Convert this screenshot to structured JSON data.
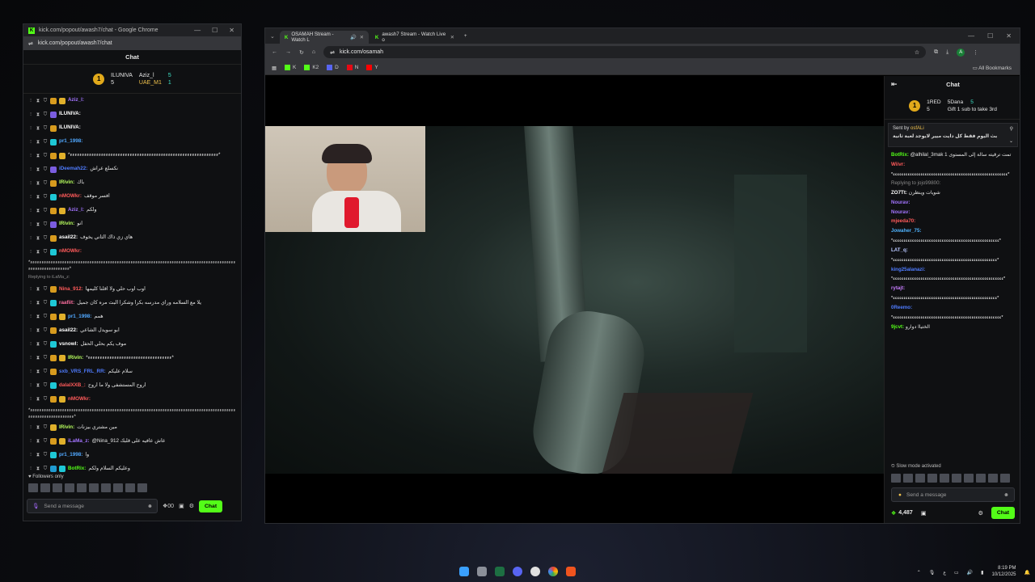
{
  "popout": {
    "window_title": "kick.com/popout/awash7/chat - Google Chrome",
    "url": "kick.com/popout/awash7/chat",
    "chat_title": "Chat",
    "pinned": {
      "rank": "1",
      "user1": "ILUNIVA",
      "user1_count": "5",
      "user2": "Aziz_l",
      "user2_count": "5",
      "user3": "UAE_M1",
      "user3_count": "1"
    },
    "messages": [
      {
        "user": "Aziz_l:",
        "text": "",
        "color": "#a374ff"
      },
      {
        "user": "ILUNIVA:",
        "text": "",
        "color": "#ffffff"
      },
      {
        "user": "ILUNIVA:",
        "text": "",
        "color": "#ffffff"
      },
      {
        "user": "pr1_1998:",
        "text": "",
        "color": "#50a8ff"
      },
      {
        "user": "",
        "text": "*ءءءءءءءءءءءءءءءءءءءءءءءءءءءءءءءءءءءءءءءءءءءءءءءءءءءءءءءءءءءءءء*",
        "color": "#ffffff"
      },
      {
        "user": "iDeemah22:",
        "text": "نكسلع عراش",
        "color": "#4f7cff"
      },
      {
        "user": "IRivin:",
        "text": "باك",
        "color": "#b8ff5e"
      },
      {
        "user": "nMOWkr:",
        "text": "افسر موقف",
        "color": "#ff5a5a"
      },
      {
        "user": "Aziz_l:",
        "text": "ولكم",
        "color": "#a374ff"
      },
      {
        "user": "IRivin:",
        "text": "انو",
        "color": "#b8ff5e"
      },
      {
        "user": "asail22:",
        "text": "هاي زي ذاك الثاني يخوف",
        "color": "#ffffff"
      },
      {
        "user": "nMOWkr:",
        "text": "",
        "color": "#ff5a5a"
      }
    ],
    "spam_block": "*ءءءءءءءءءءءءءءءءءءءءءءءءءءءءءءءءءءءءءءءءءءءءءءءءءءءءءءءءءءءءءءءءءءءءءءءءءءءءءءءءءءءءءءءءءءءءءءءءءءءءءءءءءءءء*",
    "reply_label": "Replying to iLaMa_z:",
    "messages2": [
      {
        "user": "Nina_912:",
        "text": "اوب اوب حلي ولا اقلنا كليمها",
        "color": "#ff5a5a"
      },
      {
        "user": "raafiit:",
        "text": "يلا مع السلامه وراي مدرسه بكرا وشكرا البث مره كان جميل",
        "color": "#ff6fa0"
      },
      {
        "user": "pr1_1998:",
        "text": "همم",
        "color": "#50a8ff"
      },
      {
        "user": "asail22:",
        "text": "ابو سويدل الشاعي",
        "color": "#ffffff"
      },
      {
        "user": "vsnowl:",
        "text": "موف يكم بحلي الحفل",
        "color": "#ffffff"
      },
      {
        "user": "IRivin:",
        "text": "*ءءءءءءءءءءءءءءءءءءءءءءءءءءءءءءءءءءء*",
        "color": "#b8ff5e"
      },
      {
        "user": "sxb_VRS_FRL_RR:",
        "text": "سلام عليكم",
        "color": "#4f7cff"
      },
      {
        "user": "dalalXXB_:",
        "text": "اروح المستشفى ولا ما اروح",
        "color": "#ff5a5a"
      },
      {
        "user": "nMOWkr:",
        "text": "",
        "color": "#ff5a5a"
      }
    ],
    "spam_block2": "*ءءءءءءءءءءءءءءءءءءءءءءءءءءءءءءءءءءءءءءءءءءءءءءءءءءءءءءءءءءءءءءءءءءءءءءءءءءءءءءءءءءءءءءءءءءءءءءءءءءءءءءءءءءءءءء*",
    "messages3": [
      {
        "user": "IRivin:",
        "text": "مين مشتري بيزنات",
        "color": "#b8ff5e"
      },
      {
        "user": "iLaMa_z:",
        "text": "@Nina_912 عاش عافيه على قلبك",
        "color": "#a374ff"
      },
      {
        "user": "pr1_1998:",
        "text": "وا",
        "color": "#50a8ff"
      },
      {
        "user": "BotRix:",
        "text": "وعليكم السلام ولكم",
        "color": "#53fc18"
      }
    ],
    "followers_only": "Followers only",
    "input_placeholder": "Send a message",
    "chat_button": "Chat",
    "points": "00"
  },
  "main": {
    "tabs": [
      {
        "label": "OSAMAH Stream - Watch L"
      },
      {
        "label": "awash7 Stream - Watch Live o"
      }
    ],
    "new_tab": "+",
    "url": "kick.com/osamah",
    "bookmarks": [
      {
        "label": "K",
        "color": "#53fc18"
      },
      {
        "label": "K2",
        "color": "#53fc18"
      },
      {
        "label": "D",
        "color": "#5865f2"
      },
      {
        "label": "N",
        "color": "#e50914"
      },
      {
        "label": "Y",
        "color": "#ff0000"
      }
    ],
    "all_bookmarks": "All Bookmarks",
    "chat_title": "Chat",
    "pinned": {
      "user1": "1RED",
      "user1_count": "5",
      "user2": "5Dana",
      "user2_count": "5",
      "gift": "Gift 1 sub to take 3rd"
    },
    "banner_sender": "Sent by",
    "banner_user": "osfALi",
    "banner_text": "بث اليوم فقط كل دايت ميير لايوجد لعبة ثانية",
    "side_messages": [
      {
        "user": "BotRix:",
        "text": "@alhilal_3mak تمت ترقيته سالة إلى المستوى 1",
        "color": "#53fc18"
      },
      {
        "user": "Wiivr:",
        "text": "",
        "color": "#ff5a5a"
      },
      {
        "user": "",
        "text": "*ءءءءءءءءءءءءءءءءءءءءءءءءءءءءءءءءءءءءءءءءءءءءءءءءءءءءءء*",
        "color": "#ffffff"
      },
      {
        "user": "",
        "text": "Replying to jojo99800:",
        "color": "#8a8a8a"
      },
      {
        "user": "ZO7Tt:",
        "text": "شويات وينظرن",
        "color": "#ffffff"
      },
      {
        "user": "Nourav:",
        "text": "",
        "color": "#a374ff"
      },
      {
        "user": "Nourav:",
        "text": "",
        "color": "#a374ff"
      },
      {
        "user": "mjeeda70:",
        "text": "",
        "color": "#ff5a5a"
      },
      {
        "user": "Jowaher_75:",
        "text": "",
        "color": "#4fb4ff"
      },
      {
        "user": "",
        "text": "*ءءءءءءءءءءءءءءءءءءءءءءءءءءءءءءءءءءءءءءءءءءءءءءءءءء*",
        "color": "#ffffff"
      },
      {
        "user": "LAT_q:",
        "text": "",
        "color": "#b9c7ff"
      },
      {
        "user": "",
        "text": "*ءءءءءءءءءءءءءءءءءءءءءءءءءءءءءءءءءءءءءءءءءءءءءءءءء*",
        "color": "#ffffff"
      },
      {
        "user": "king25alanazi:",
        "text": "",
        "color": "#4f7cff"
      },
      {
        "user": "",
        "text": "*ءءءءءءءءءءءءءءءءءءءءءءءءءءءءءءءءءءءءءءءءءءءءءءءءءءءء*",
        "color": "#ffffff"
      },
      {
        "user": "rytajt:",
        "text": "",
        "color": "#c77dff"
      },
      {
        "user": "",
        "text": "*ءءءءءءءءءءءءءءءءءءءءءءءءءءءءءءءءءءءءءءءءءءءءءءءءء*",
        "color": "#ffffff"
      },
      {
        "user": "0Reemo:",
        "text": "",
        "color": "#4f7cff"
      },
      {
        "user": "",
        "text": "*ءءءءءءءءءءءءءءءءءءءءءءءءءءءءءءءءءءءءءءءءءءءءءءءءءءء*",
        "color": "#ffffff"
      },
      {
        "user": "9jcvt:",
        "text": "الختياا دوارو",
        "color": "#53fc18"
      }
    ],
    "slow_mode": "Slow mode activated",
    "input_placeholder": "Send a message",
    "points": "4,487",
    "chat_button": "Chat"
  },
  "taskbar": {
    "time": "8:19 PM",
    "date": "10/12/2025",
    "lang": "ع"
  }
}
